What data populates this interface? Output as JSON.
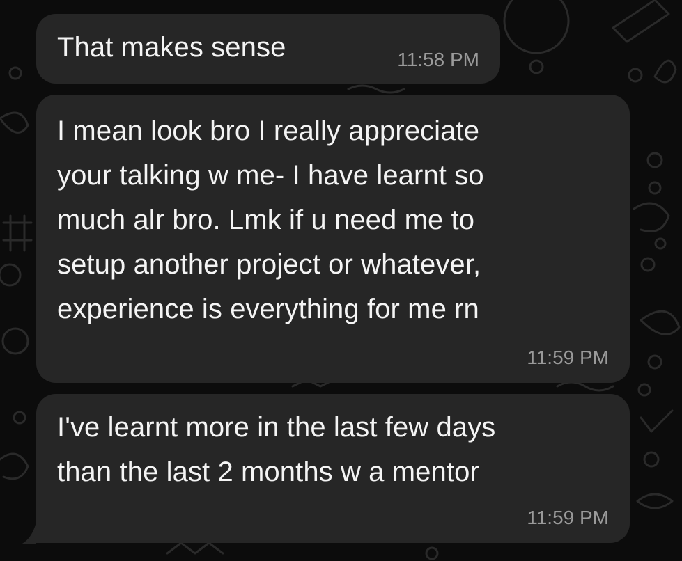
{
  "theme": {
    "background": "#0c0c0c",
    "bubble_color": "#262626",
    "text_color": "#f4f4f4",
    "time_color": "#9a9a9a",
    "wallpaper_doodle_color": "#2a2a2a"
  },
  "messages": [
    {
      "text": "That makes sense",
      "time": "11:58 PM"
    },
    {
      "text": "I mean look bro I really appreciate\nyour talking w me- I have learnt so\nmuch alr bro. Lmk if u need me to\nsetup another project or whatever,\nexperience is everything for me rn",
      "time": "11:59 PM"
    },
    {
      "text": "I've learnt more in the last few days\nthan the last 2 months w a mentor",
      "time": "11:59 PM"
    }
  ]
}
